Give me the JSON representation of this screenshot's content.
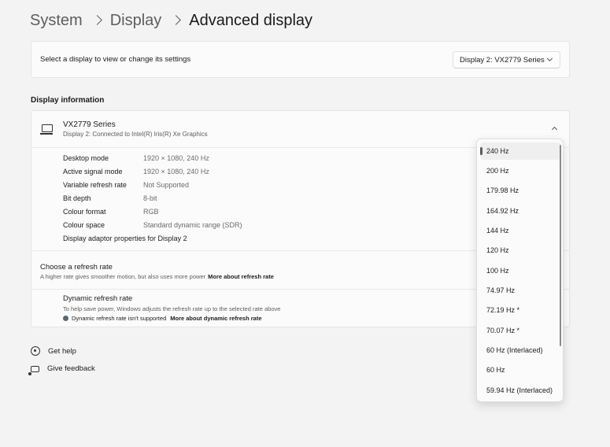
{
  "breadcrumb": {
    "items": [
      "System",
      "Display"
    ],
    "current": "Advanced display"
  },
  "display_select": {
    "label": "Select a display to view or change its settings",
    "value": "Display 2: VX2779 Series"
  },
  "display_info": {
    "section_title": "Display information",
    "name": "VX2779 Series",
    "subtitle": "Display 2: Connected to Intel(R) Iris(R) Xe Graphics",
    "properties": [
      {
        "key": "Desktop mode",
        "value": "1920 × 1080, 240 Hz"
      },
      {
        "key": "Active signal mode",
        "value": "1920 × 1080, 240 Hz"
      },
      {
        "key": "Variable refresh rate",
        "value": "Not Supported"
      },
      {
        "key": "Bit depth",
        "value": "8-bit"
      },
      {
        "key": "Colour format",
        "value": "RGB"
      },
      {
        "key": "Colour space",
        "value": "Standard dynamic range (SDR)"
      }
    ],
    "adapter_link": "Display adaptor properties for Display 2"
  },
  "refresh_rate": {
    "title": "Choose a refresh rate",
    "description": "A higher rate gives smoother motion, but also uses more power",
    "link": "More about refresh rate"
  },
  "dynamic_refresh": {
    "title": "Dynamic refresh rate",
    "description": "To help save power, Windows adjusts the refresh rate up to the selected rate above",
    "status": "Dynamic refresh rate isn't supported",
    "link": "More about dynamic refresh rate"
  },
  "help": {
    "get_help": "Get help",
    "give_feedback": "Give feedback"
  },
  "refresh_dropdown": {
    "selected": "240 Hz",
    "options": [
      "240 Hz",
      "200 Hz",
      "179.98 Hz",
      "164.92 Hz",
      "144 Hz",
      "120 Hz",
      "100 Hz",
      "74.97 Hz",
      "72.19 Hz *",
      "70.07 Hz *",
      "60 Hz (Interlaced)",
      "60 Hz",
      "59.94 Hz (Interlaced)"
    ]
  },
  "icons": {
    "display": "monitor-icon",
    "help": "help-icon",
    "feedback": "feedback-icon",
    "status": "info-dot-icon"
  }
}
